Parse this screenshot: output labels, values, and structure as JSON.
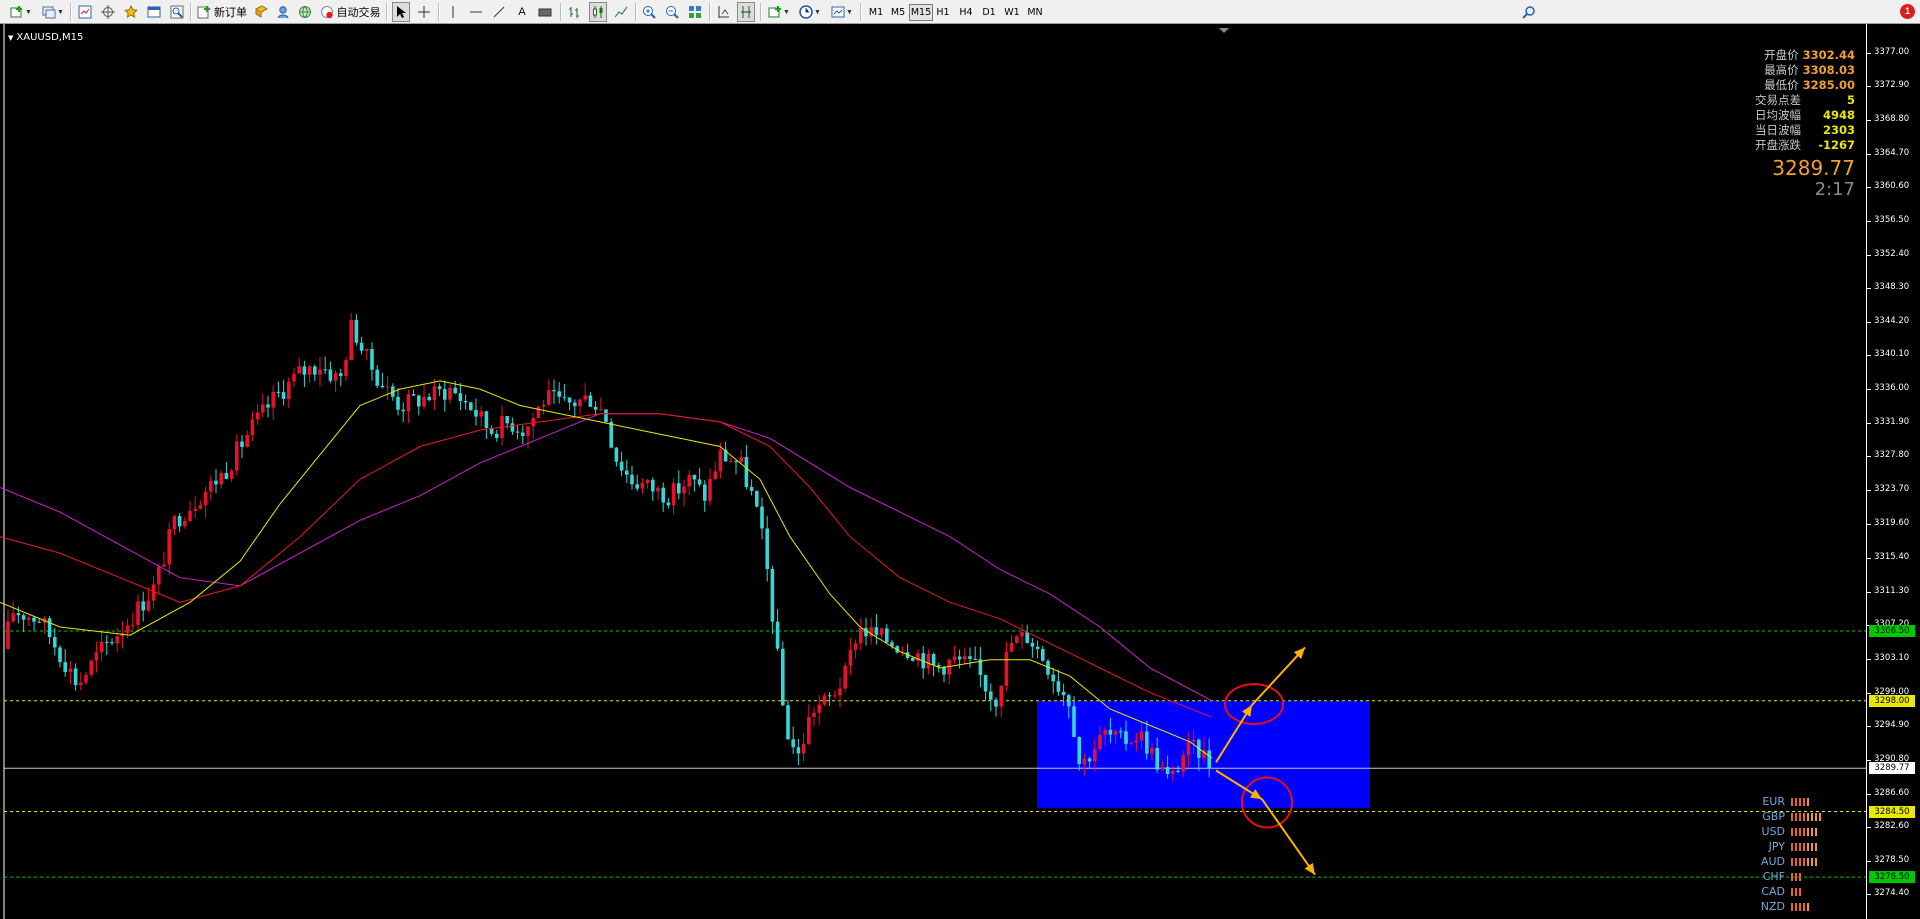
{
  "toolbar": {
    "new_order_label": "新订单",
    "auto_trading_label": "自动交易",
    "text_tool_label": "A",
    "timeframes": [
      {
        "label": "M1",
        "active": false
      },
      {
        "label": "M5",
        "active": false
      },
      {
        "label": "M15",
        "active": true
      },
      {
        "label": "H1",
        "active": false
      },
      {
        "label": "H4",
        "active": false
      },
      {
        "label": "D1",
        "active": false
      },
      {
        "label": "W1",
        "active": false
      },
      {
        "label": "MN",
        "active": false
      }
    ],
    "notification_count": "1"
  },
  "chart": {
    "symbol_label": "XAUUSD,M15",
    "bid_price": "3289.77",
    "bar_countdown": "2:17",
    "info_panel": [
      {
        "label": "开盘价",
        "value": "3302.44",
        "color": "#f0a030"
      },
      {
        "label": "最高价",
        "value": "3308.03",
        "color": "#f0a030"
      },
      {
        "label": "最低价",
        "value": "3285.00",
        "color": "#f0a030"
      },
      {
        "label": "交易点差",
        "value": "5",
        "color": "#e8e800"
      },
      {
        "label": "日均波幅",
        "value": "4948",
        "color": "#e8e800"
      },
      {
        "label": "当日波幅",
        "value": "2303",
        "color": "#e8e800"
      },
      {
        "label": "开盘涨跌",
        "value": "-1267",
        "color": "#e8e800"
      }
    ],
    "price_ticks": [
      "3377.00",
      "3372.90",
      "3368.80",
      "3364.70",
      "3360.60",
      "3356.50",
      "3352.40",
      "3348.30",
      "3344.20",
      "3340.10",
      "3336.00",
      "3331.90",
      "3327.80",
      "3323.70",
      "3319.60",
      "3315.40",
      "3311.30",
      "3307.20",
      "3303.10",
      "3299.00",
      "3294.90",
      "3290.80",
      "3286.60",
      "3282.60",
      "3278.50",
      "3274.40"
    ],
    "levels": [
      {
        "price": 3306.5,
        "label": "3306.50",
        "color": "#00c800",
        "tag_bg": "#00c800",
        "tag_fg": "#000000"
      },
      {
        "price": 3298.0,
        "label": "3298.00",
        "color": "#e8e800",
        "tag_bg": "#e8e800",
        "tag_fg": "#000000"
      },
      {
        "price": 3289.77,
        "label": "3289.77",
        "color": "#c8c8c8",
        "tag_bg": "#ffffff",
        "tag_fg": "#000000"
      },
      {
        "price": 3284.5,
        "label": "3284.50",
        "color": "#e8e800",
        "tag_bg": "#e8e800",
        "tag_fg": "#000000"
      },
      {
        "price": 3276.5,
        "label": "3276.50",
        "color": "#00c800",
        "tag_bg": "#00c800",
        "tag_fg": "#000000"
      }
    ],
    "currency_strength": [
      {
        "name": "EUR",
        "bars": 5,
        "color": "#e8651c"
      },
      {
        "name": "GBP",
        "bars": 8,
        "color": "#e8651c"
      },
      {
        "name": "USD",
        "bars": 7,
        "color": "#e8651c"
      },
      {
        "name": "JPY",
        "bars": 7,
        "color": "#e8651c"
      },
      {
        "name": "AUD",
        "bars": 7,
        "color": "#e8651c"
      },
      {
        "name": "CHF",
        "bars": 3,
        "color": "#e8651c"
      },
      {
        "name": "CAD",
        "bars": 3,
        "color": "#e8651c"
      },
      {
        "name": "NZD",
        "bars": 5,
        "color": "#e8651c"
      }
    ],
    "colors": {
      "bull_candle": "#e8112d",
      "bear_candle": "#36d6d6",
      "ma_fast": "#e8e800",
      "ma_mid": "#e81c1c",
      "ma_slow": "#d020d0",
      "zone_fill": "#0000ff",
      "arrow": "#ffb000",
      "circle": "#e81010"
    }
  },
  "chart_data": {
    "type": "candlestick",
    "symbol": "XAUUSD",
    "timeframe": "M15",
    "y_range": [
      3271.4,
      3380.5
    ],
    "close_path": [
      [
        0,
        3302
      ],
      [
        12,
        3309
      ],
      [
        40,
        3308
      ],
      [
        78,
        3300
      ],
      [
        100,
        3304
      ],
      [
        130,
        3308
      ],
      [
        155,
        3312
      ],
      [
        175,
        3320
      ],
      [
        200,
        3323
      ],
      [
        225,
        3326
      ],
      [
        250,
        3331
      ],
      [
        275,
        3335
      ],
      [
        300,
        3338
      ],
      [
        320,
        3339
      ],
      [
        340,
        3337
      ],
      [
        352,
        3344
      ],
      [
        365,
        3340
      ],
      [
        380,
        3337
      ],
      [
        400,
        3334
      ],
      [
        425,
        3335
      ],
      [
        450,
        3336
      ],
      [
        470,
        3334
      ],
      [
        490,
        3331
      ],
      [
        510,
        3332
      ],
      [
        525,
        3331
      ],
      [
        545,
        3335
      ],
      [
        565,
        3334
      ],
      [
        590,
        3335
      ],
      [
        605,
        3333
      ],
      [
        615,
        3328
      ],
      [
        630,
        3325
      ],
      [
        650,
        3324
      ],
      [
        670,
        3323
      ],
      [
        690,
        3325
      ],
      [
        705,
        3323
      ],
      [
        720,
        3328
      ],
      [
        740,
        3327
      ],
      [
        755,
        3322
      ],
      [
        765,
        3316
      ],
      [
        775,
        3306
      ],
      [
        785,
        3295
      ],
      [
        798,
        3291
      ],
      [
        812,
        3297
      ],
      [
        828,
        3298
      ],
      [
        845,
        3301
      ],
      [
        858,
        3307
      ],
      [
        875,
        3306
      ],
      [
        895,
        3305
      ],
      [
        915,
        3304
      ],
      [
        935,
        3302
      ],
      [
        955,
        3303
      ],
      [
        975,
        3302
      ],
      [
        995,
        3298
      ],
      [
        1010,
        3305
      ],
      [
        1028,
        3306
      ],
      [
        1045,
        3303
      ],
      [
        1058,
        3300
      ],
      [
        1070,
        3298
      ],
      [
        1080,
        3290
      ],
      [
        1092,
        3292
      ],
      [
        1105,
        3294
      ],
      [
        1120,
        3293
      ],
      [
        1140,
        3294
      ],
      [
        1155,
        3291
      ],
      [
        1170,
        3288
      ],
      [
        1185,
        3292
      ],
      [
        1200,
        3292
      ],
      [
        1212,
        3290
      ]
    ],
    "ma_fast": [
      [
        0,
        3310
      ],
      [
        60,
        3307
      ],
      [
        130,
        3306
      ],
      [
        190,
        3310
      ],
      [
        240,
        3315
      ],
      [
        280,
        3322
      ],
      [
        320,
        3328
      ],
      [
        360,
        3334
      ],
      [
        400,
        3336
      ],
      [
        440,
        3337
      ],
      [
        480,
        3336
      ],
      [
        520,
        3334
      ],
      [
        560,
        3333
      ],
      [
        600,
        3332
      ],
      [
        640,
        3331
      ],
      [
        680,
        3330
      ],
      [
        720,
        3329
      ],
      [
        760,
        3325
      ],
      [
        790,
        3318
      ],
      [
        830,
        3311
      ],
      [
        860,
        3307
      ],
      [
        900,
        3304
      ],
      [
        940,
        3302
      ],
      [
        990,
        3303
      ],
      [
        1030,
        3303
      ],
      [
        1070,
        3301
      ],
      [
        1110,
        3297
      ],
      [
        1150,
        3295
      ],
      [
        1190,
        3293
      ],
      [
        1212,
        3291
      ]
    ],
    "ma_mid": [
      [
        0,
        3318
      ],
      [
        60,
        3316
      ],
      [
        120,
        3313
      ],
      [
        180,
        3310
      ],
      [
        240,
        3312
      ],
      [
        300,
        3318
      ],
      [
        360,
        3325
      ],
      [
        420,
        3329
      ],
      [
        480,
        3331
      ],
      [
        540,
        3332
      ],
      [
        600,
        3333
      ],
      [
        660,
        3333
      ],
      [
        720,
        3332
      ],
      [
        770,
        3329
      ],
      [
        810,
        3324
      ],
      [
        850,
        3318
      ],
      [
        900,
        3313
      ],
      [
        950,
        3310
      ],
      [
        1000,
        3308
      ],
      [
        1050,
        3305
      ],
      [
        1100,
        3302
      ],
      [
        1150,
        3299
      ],
      [
        1212,
        3296
      ]
    ],
    "ma_slow": [
      [
        0,
        3324
      ],
      [
        60,
        3321
      ],
      [
        120,
        3317
      ],
      [
        180,
        3313
      ],
      [
        240,
        3312
      ],
      [
        300,
        3316
      ],
      [
        360,
        3320
      ],
      [
        420,
        3323
      ],
      [
        480,
        3327
      ],
      [
        540,
        3330
      ],
      [
        600,
        3333
      ],
      [
        660,
        3333
      ],
      [
        720,
        3332
      ],
      [
        770,
        3330
      ],
      [
        810,
        3327
      ],
      [
        850,
        3324
      ],
      [
        900,
        3321
      ],
      [
        950,
        3318
      ],
      [
        1000,
        3314
      ],
      [
        1050,
        3311
      ],
      [
        1100,
        3307
      ],
      [
        1150,
        3302
      ],
      [
        1212,
        3298
      ]
    ],
    "zone": {
      "x_start": 1037,
      "x_end": 1370,
      "price_top": 3298.0,
      "price_bottom": 3284.9
    },
    "scenario_arrows": [
      {
        "from": [
          1216,
          3290.5
        ],
        "to": [
          1252,
          3297.5
        ]
      },
      {
        "from": [
          1252,
          3297.5
        ],
        "to": [
          1305,
          3304.5
        ]
      },
      {
        "from": [
          1216,
          3289.5
        ],
        "to": [
          1262,
          3286.0
        ]
      },
      {
        "from": [
          1262,
          3286.0
        ],
        "to": [
          1315,
          3276.8
        ]
      }
    ],
    "circles": [
      {
        "cx": 1254,
        "price": 3297.6,
        "rx": 29,
        "ry": 20
      },
      {
        "cx": 1267,
        "price": 3285.6,
        "rx": 25,
        "ry": 25
      }
    ]
  }
}
